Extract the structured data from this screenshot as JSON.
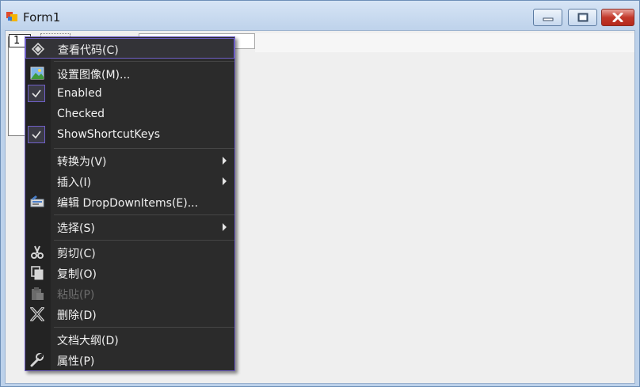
{
  "window": {
    "title": "Form1",
    "colors": {
      "frame": "#c9d9ec",
      "close_red": "#c2392b",
      "menu_bg": "#2b2b2b",
      "menu_border": "#6f5fc7"
    }
  },
  "form": {
    "tab_label": "1"
  },
  "context_menu": {
    "items": [
      {
        "label": "查看代码(C)",
        "icon": "view-code-icon",
        "highlighted": true
      },
      {
        "label": "设置图像(M)...",
        "icon": "image-icon"
      },
      {
        "label": "Enabled",
        "icon": "checkmark-icon",
        "checked": true
      },
      {
        "label": "Checked",
        "checked": false
      },
      {
        "label": "ShowShortcutKeys",
        "icon": "checkmark-icon",
        "checked": true
      },
      {
        "label": "转换为(V)",
        "submenu": true
      },
      {
        "label": "插入(I)",
        "submenu": true
      },
      {
        "label": "编辑 DropDownItems(E)...",
        "icon": "edit-items-icon"
      },
      {
        "label": "选择(S)",
        "submenu": true
      },
      {
        "label": "剪切(C)",
        "icon": "scissors-icon"
      },
      {
        "label": "复制(O)",
        "icon": "copy-icon"
      },
      {
        "label": "粘贴(P)",
        "icon": "paste-icon",
        "disabled": true
      },
      {
        "label": "删除(D)",
        "icon": "delete-icon"
      },
      {
        "label": "文档大纲(D)"
      },
      {
        "label": "属性(P)",
        "icon": "wrench-icon"
      }
    ]
  }
}
